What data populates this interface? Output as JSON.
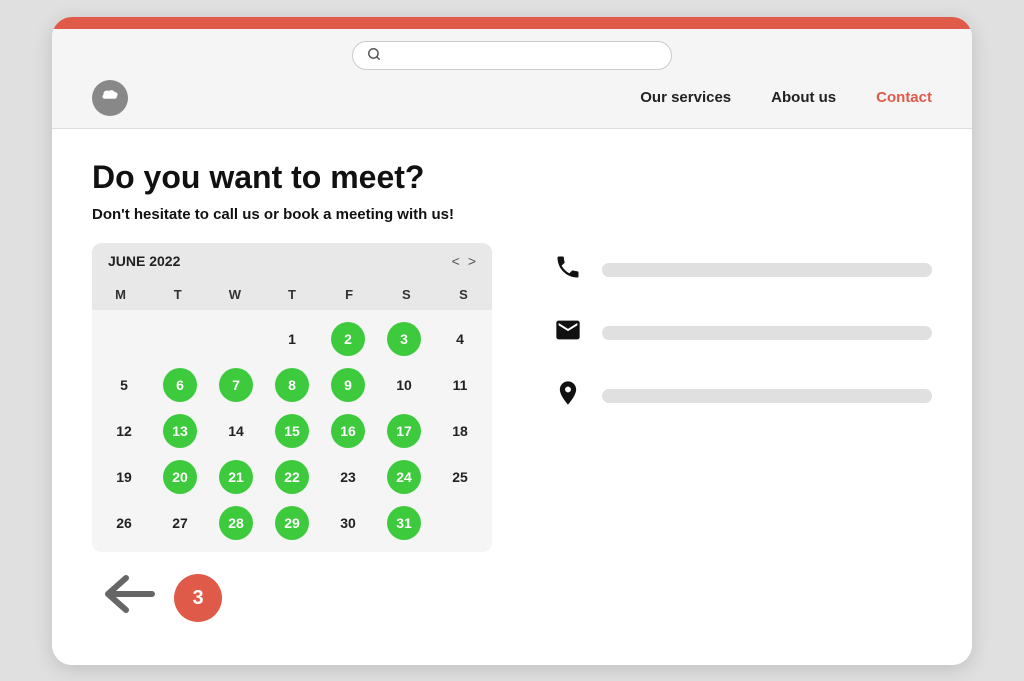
{
  "browser": {
    "top_bar_color": "#e05a4a"
  },
  "search": {
    "placeholder": "",
    "icon": "🔍"
  },
  "nav": {
    "logo_icon": "☁",
    "links": [
      {
        "label": "Our services",
        "active": false
      },
      {
        "label": "About us",
        "active": false
      },
      {
        "label": "Contact",
        "active": true
      }
    ]
  },
  "page": {
    "title": "Do you want to meet?",
    "subtitle": "Don't hesitate to call us or book a meeting with us!"
  },
  "calendar": {
    "month_label": "JUNE 2022",
    "nav_prev": "<",
    "nav_next": ">",
    "weekdays": [
      "M",
      "T",
      "W",
      "T",
      "F",
      "S",
      "S"
    ],
    "rows": [
      [
        null,
        null,
        null,
        1,
        "2g",
        "3g",
        4,
        5
      ],
      [
        "6g",
        "7g",
        "8g",
        "9g",
        10,
        11,
        12
      ],
      [
        "13g",
        14,
        "15g",
        "16g",
        "17g",
        18,
        19
      ],
      [
        "20g",
        "21g",
        "22g",
        23,
        "24g",
        25,
        26
      ],
      [
        27,
        "28g",
        "29g",
        30,
        "31g",
        null,
        null
      ]
    ]
  },
  "badge": {
    "value": "3"
  },
  "contact": {
    "phone_icon": "📞",
    "email_icon": "✉",
    "location_icon": "📍"
  }
}
